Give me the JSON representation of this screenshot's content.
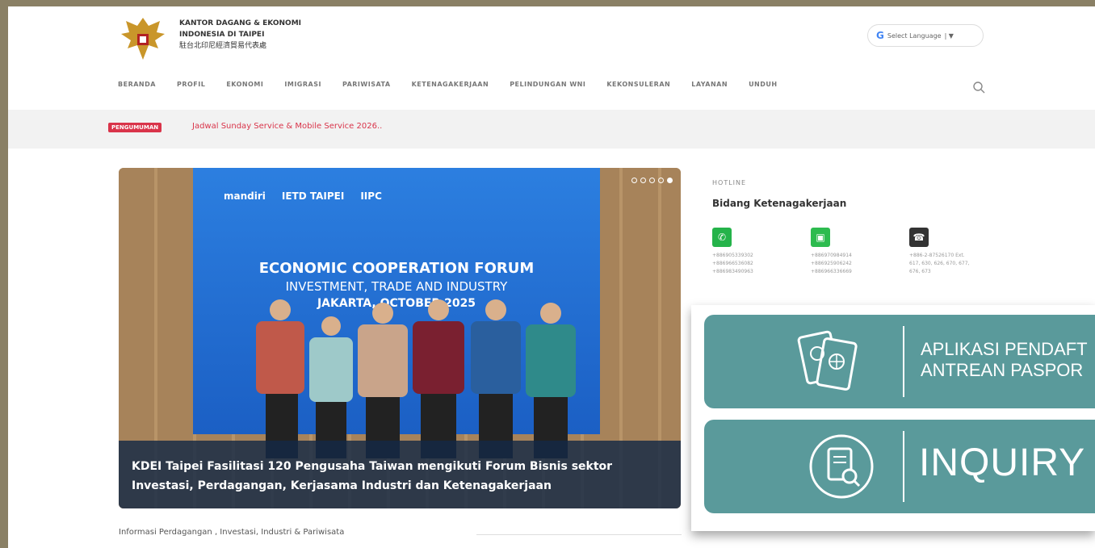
{
  "header": {
    "org_line1": "KANTOR DAGANG & EKONOMI",
    "org_line2": "INDONESIA DI TAIPEI",
    "org_line3": "駐台北印尼經濟貿易代表處",
    "language_select": "Select Language"
  },
  "nav": [
    "BERANDA",
    "PROFIL",
    "EKONOMI",
    "IMIGRASI",
    "PARIWISATA",
    "KETENAGAKERJAAN",
    "PELINDUNGAN WNI",
    "KEKONSULERAN",
    "LAYANAN",
    "UNDUH"
  ],
  "ticker": {
    "badge": "PENGUMUMAN",
    "text": "Jadwal Sunday Service & Mobile Service 2026.."
  },
  "slider": {
    "event_title": "ECONOMIC COOPERATION FORUM",
    "event_subtitle": "INVESTMENT, TRADE AND INDUSTRY",
    "event_place_date": "JAKARTA, OCTOBER 2025",
    "logos": [
      "mandiri",
      "IETD TAIPEI",
      "IIPC"
    ],
    "caption": "KDEI Taipei Fasilitasi 120 Pengusaha Taiwan mengikuti Forum Bisnis sektor Investasi, Perdagangan, Kerjasama Industri dan Ketenagakerjaan",
    "dots": [
      false,
      false,
      false,
      false,
      true
    ]
  },
  "section_heading": "Informasi Perdagangan , Investasi, Industri & Pariwisata",
  "hotline": {
    "label": "HOTLINE",
    "department": "Bidang Ketenagakerjaan",
    "whatsapp": [
      "+886905339302",
      "+886966536082",
      "+886983490963"
    ],
    "line": [
      "+886970984914",
      "+886925906242",
      "+886966336669"
    ],
    "phone": [
      "+886-2-87526170 Ext.",
      "617, 630, 626, 670, 677,",
      "676, 673"
    ],
    "colors": {
      "whatsapp": "#25b34a",
      "line": "#2dbb4f",
      "phone": "#333333"
    }
  },
  "banners": {
    "passport_line1": "APLIKASI PENDAFT",
    "passport_line2": "ANTREAN PASPOR",
    "inquiry": "INQUIRY",
    "color": "#5a9a9b"
  }
}
